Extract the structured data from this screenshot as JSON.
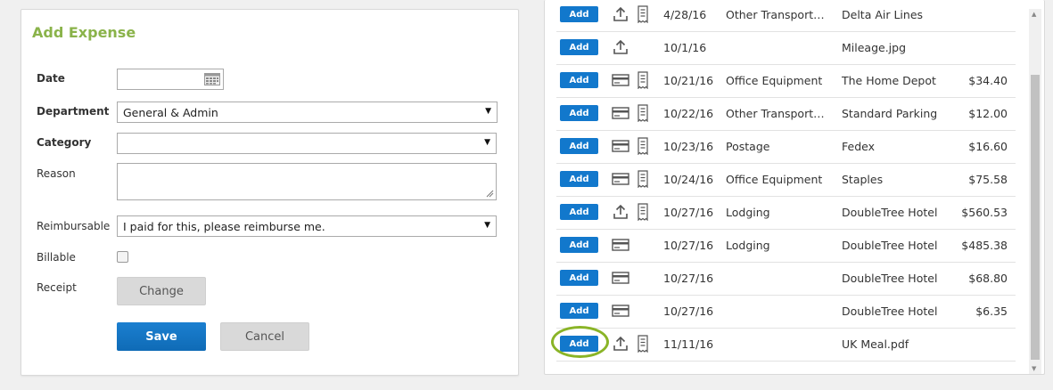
{
  "form": {
    "title": "Add Expense",
    "date_label": "Date",
    "date_value": "",
    "department_label": "Department",
    "department_value": "General & Admin",
    "category_label": "Category",
    "category_value": "",
    "reason_label": "Reason",
    "reason_value": "",
    "reimbursable_label": "Reimbursable",
    "reimbursable_value": "I paid for this, please reimburse me.",
    "billable_label": "Billable",
    "billable_checked": false,
    "receipt_label": "Receipt",
    "change_label": "Change",
    "save_label": "Save",
    "cancel_label": "Cancel"
  },
  "colors": {
    "accent_green": "#8ab34a",
    "primary_blue": "#1278cc",
    "highlight_ring": "#8ab427"
  },
  "expenses": [
    {
      "add": "Add",
      "icon": "upload-icon",
      "date": "4/28/16",
      "category": "Other Transportation",
      "vendor": "Delta Air Lines",
      "amount": ""
    },
    {
      "add": "Add",
      "icon": "upload-icon",
      "date": "10/1/16",
      "category": "",
      "vendor": "Mileage.jpg",
      "amount": ""
    },
    {
      "add": "Add",
      "icon": "credit-card-icon",
      "date": "10/21/16",
      "category": "Office Equipment",
      "vendor": "The Home Depot",
      "amount": "$34.40"
    },
    {
      "add": "Add",
      "icon": "credit-card-icon",
      "date": "10/22/16",
      "category": "Other Transportation",
      "vendor": "Standard Parking",
      "amount": "$12.00"
    },
    {
      "add": "Add",
      "icon": "credit-card-icon",
      "date": "10/23/16",
      "category": "Postage",
      "vendor": "Fedex",
      "amount": "$16.60"
    },
    {
      "add": "Add",
      "icon": "credit-card-icon",
      "date": "10/24/16",
      "category": "Office Equipment",
      "vendor": "Staples",
      "amount": "$75.58"
    },
    {
      "add": "Add",
      "icon": "upload-icon",
      "date": "10/27/16",
      "category": "Lodging",
      "vendor": "DoubleTree Hotel",
      "amount": "$560.53"
    },
    {
      "add": "Add",
      "icon": "credit-card-icon",
      "date": "10/27/16",
      "category": "Lodging",
      "vendor": "DoubleTree Hotel",
      "amount": "$485.38"
    },
    {
      "add": "Add",
      "icon": "credit-card-icon",
      "date": "10/27/16",
      "category": "",
      "vendor": "DoubleTree Hotel",
      "amount": "$68.80"
    },
    {
      "add": "Add",
      "icon": "credit-card-icon",
      "date": "10/27/16",
      "category": "",
      "vendor": "DoubleTree Hotel",
      "amount": "$6.35"
    },
    {
      "add": "Add",
      "icon": "upload-icon",
      "date": "11/11/16",
      "category": "",
      "vendor": "UK Meal.pdf",
      "amount": ""
    }
  ],
  "receipt_rows": [
    true,
    false,
    true,
    true,
    true,
    true,
    true,
    false,
    false,
    false,
    true
  ]
}
